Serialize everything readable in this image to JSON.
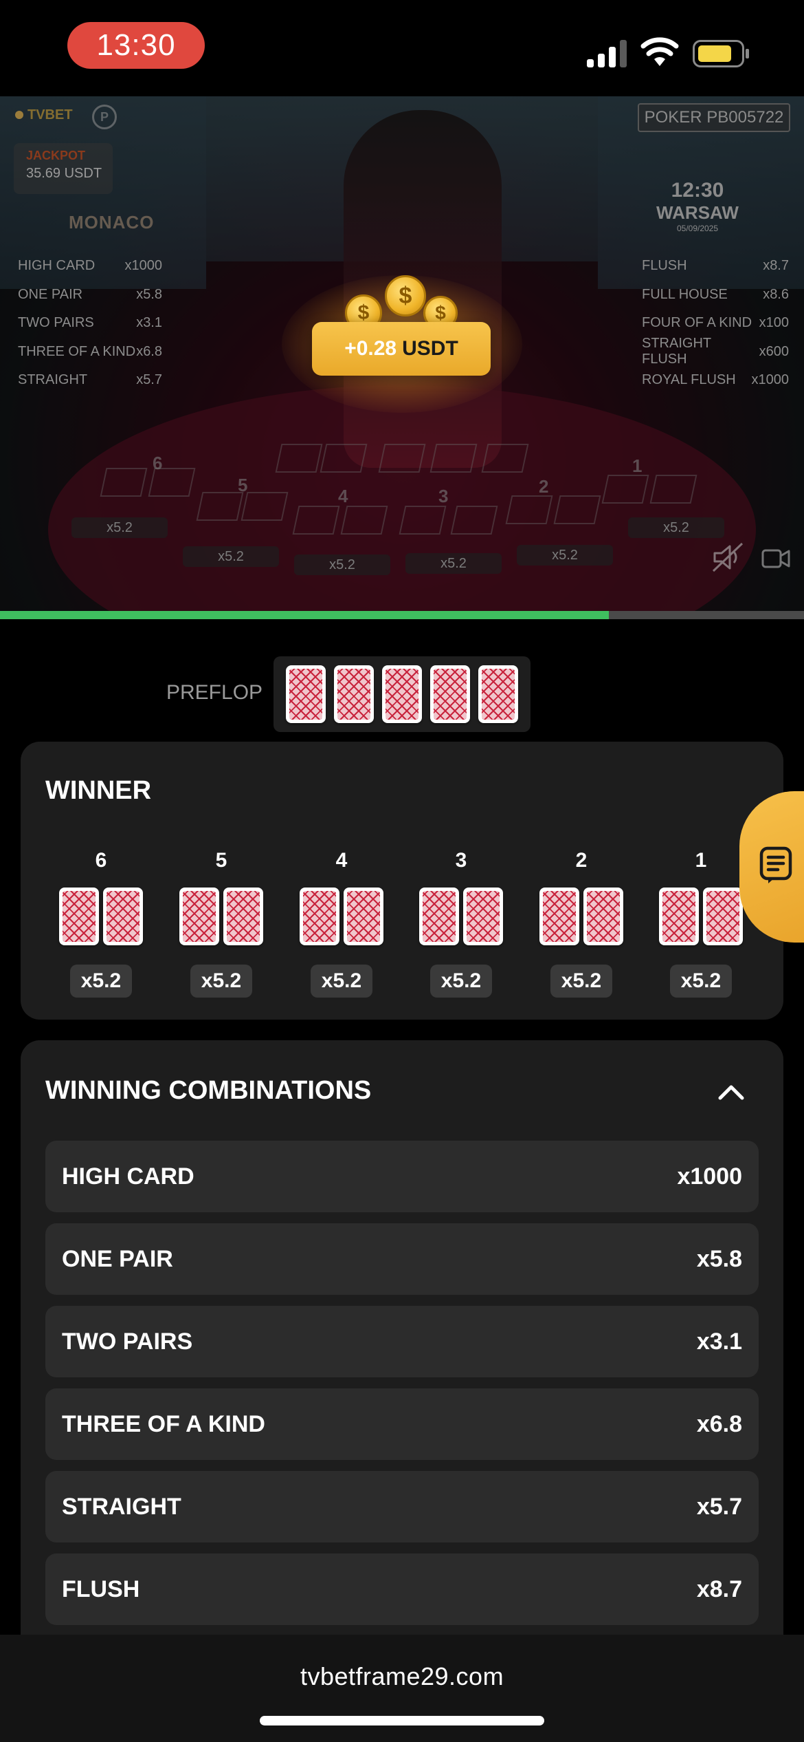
{
  "status_bar": {
    "time": "13:30"
  },
  "video": {
    "brand": "TVBET",
    "game_id": "POKER  PB005722",
    "jackpot": {
      "label": "JACKPOT",
      "value": "35.69 USDT"
    },
    "venue": "MONACO",
    "clock": {
      "time": "12:30",
      "city": "WARSAW",
      "date": "05/09/2025"
    },
    "paytable_left": [
      {
        "name": "HIGH CARD",
        "mult": "x1000"
      },
      {
        "name": "ONE PAIR",
        "mult": "x5.8"
      },
      {
        "name": "TWO PAIRS",
        "mult": "x3.1"
      },
      {
        "name": "THREE OF A KIND",
        "mult": "x6.8"
      },
      {
        "name": "STRAIGHT",
        "mult": "x5.7"
      }
    ],
    "paytable_right": [
      {
        "name": "FLUSH",
        "mult": "x8.7"
      },
      {
        "name": "FULL HOUSE",
        "mult": "x8.6"
      },
      {
        "name": "FOUR OF A KIND",
        "mult": "x100"
      },
      {
        "name": "STRAIGHT FLUSH",
        "mult": "x600"
      },
      {
        "name": "ROYAL FLUSH",
        "mult": "x1000"
      }
    ],
    "spot_numbers": [
      "6",
      "5",
      "4",
      "3",
      "2",
      "1"
    ],
    "spot_multipliers": [
      "x5.2",
      "x5.2",
      "x5.2",
      "x5.2",
      "x5.2",
      "x5.2"
    ],
    "win": {
      "amount": "+0.28",
      "currency": "USDT"
    },
    "progress": 0.757
  },
  "preflop": {
    "label": "PREFLOP",
    "cards": 5
  },
  "winner": {
    "title": "WINNER",
    "hands": [
      {
        "num": "6",
        "mult": "x5.2"
      },
      {
        "num": "5",
        "mult": "x5.2"
      },
      {
        "num": "4",
        "mult": "x5.2"
      },
      {
        "num": "3",
        "mult": "x5.2"
      },
      {
        "num": "2",
        "mult": "x5.2"
      },
      {
        "num": "1",
        "mult": "x5.2"
      }
    ]
  },
  "combinations": {
    "title": "WINNING COMBINATIONS",
    "rows": [
      {
        "name": "HIGH CARD",
        "mult": "x1000"
      },
      {
        "name": "ONE PAIR",
        "mult": "x5.8"
      },
      {
        "name": "TWO PAIRS",
        "mult": "x3.1"
      },
      {
        "name": "THREE OF A KIND",
        "mult": "x6.8"
      },
      {
        "name": "STRAIGHT",
        "mult": "x5.7"
      },
      {
        "name": "FLUSH",
        "mult": "x8.7"
      }
    ]
  },
  "browser": {
    "url": "tvbetframe29.com"
  },
  "colors": {
    "accent": "#f2b53a",
    "progress": "#3fbf5f",
    "panel": "#1d1d1d",
    "row": "#2c2c2c",
    "time_pill": "#e0483e"
  }
}
